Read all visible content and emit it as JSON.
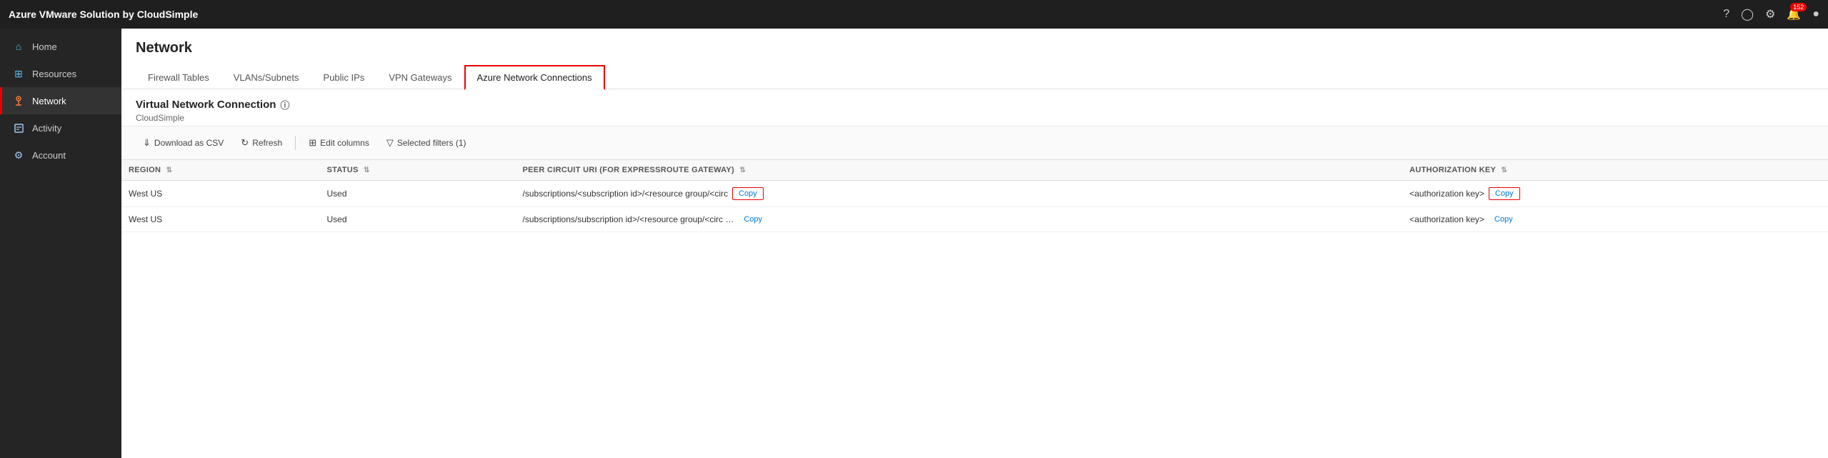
{
  "app": {
    "title": "Azure VMware Solution by CloudSimple"
  },
  "topbar": {
    "title": "Azure VMware Solution by CloudSimple",
    "icons": {
      "help": "?",
      "user_circle": "👤",
      "settings": "⚙",
      "bell": "🔔",
      "badge": "152",
      "profile": "👤"
    }
  },
  "sidebar": {
    "items": [
      {
        "id": "home",
        "label": "Home",
        "icon": "🏠",
        "active": false
      },
      {
        "id": "resources",
        "label": "Resources",
        "icon": "⊞",
        "active": false
      },
      {
        "id": "network",
        "label": "Network",
        "icon": "👤",
        "active": true
      },
      {
        "id": "activity",
        "label": "Activity",
        "icon": "📋",
        "active": false
      },
      {
        "id": "account",
        "label": "Account",
        "icon": "⚙",
        "active": false
      }
    ]
  },
  "page": {
    "title": "Network",
    "tabs": [
      {
        "id": "firewall",
        "label": "Firewall Tables",
        "active": false
      },
      {
        "id": "vlans",
        "label": "VLANs/Subnets",
        "active": false
      },
      {
        "id": "publicips",
        "label": "Public IPs",
        "active": false
      },
      {
        "id": "vpngateways",
        "label": "VPN Gateways",
        "active": false
      },
      {
        "id": "azurenetwork",
        "label": "Azure Network Connections",
        "active": true
      }
    ],
    "section_title": "Virtual Network Connection",
    "section_subtitle": "CloudSimple",
    "toolbar": {
      "download_csv": "Download as CSV",
      "refresh": "Refresh",
      "edit_columns": "Edit columns",
      "selected_filters": "Selected filters (1)"
    },
    "table": {
      "columns": [
        {
          "id": "region",
          "label": "REGION"
        },
        {
          "id": "status",
          "label": "STATUS"
        },
        {
          "id": "peer_circuit_uri",
          "label": "PEER CIRCUIT URI (FOR EXPRESSROUTE GATEWAY)"
        },
        {
          "id": "auth_key",
          "label": "AUTHORIZATION KEY"
        }
      ],
      "rows": [
        {
          "region": "West US",
          "status": "Used",
          "peer_circuit_uri": "/subscriptions/<subscription id>/<resource group/<circ",
          "peer_circuit_uri_copy_highlighted": true,
          "auth_key": "<authorization key>",
          "auth_key_copy_highlighted": true
        },
        {
          "region": "West US",
          "status": "Used",
          "peer_circuit_uri": "/subscriptions/subscription id>/<resource group/<circ …",
          "peer_circuit_uri_copy_highlighted": false,
          "auth_key": "<authorization key>",
          "auth_key_copy_highlighted": false
        }
      ]
    }
  }
}
